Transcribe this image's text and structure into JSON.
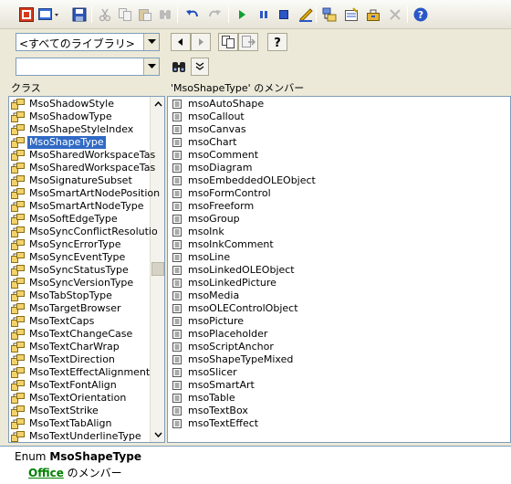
{
  "toolbar": {
    "buttons": [
      "view-code-icon",
      "view-object-icon",
      "save-icon",
      "cut-icon",
      "copy-icon",
      "paste-icon",
      "find-icon",
      "undo-icon",
      "redo-icon",
      "run-icon",
      "break-icon",
      "reset-icon",
      "design-mode-icon",
      "project-explorer-icon",
      "properties-icon",
      "toolbox-icon",
      "close-icon",
      "help-icon"
    ]
  },
  "library_combo": {
    "value": "<すべてのライブラリ>"
  },
  "search_combo": {
    "value": ""
  },
  "classes_header": "クラス",
  "members_header": "'MsoShapeType' のメンバー",
  "classes": [
    "MsoShadowStyle",
    "MsoShadowType",
    "MsoShapeStyleIndex",
    "MsoShapeType",
    "MsoSharedWorkspaceTas",
    "MsoSharedWorkspaceTas",
    "MsoSignatureSubset",
    "MsoSmartArtNodePosition",
    "MsoSmartArtNodeType",
    "MsoSoftEdgeType",
    "MsoSyncConflictResolutio",
    "MsoSyncErrorType",
    "MsoSyncEventType",
    "MsoSyncStatusType",
    "MsoSyncVersionType",
    "MsoTabStopType",
    "MsoTargetBrowser",
    "MsoTextCaps",
    "MsoTextChangeCase",
    "MsoTextCharWrap",
    "MsoTextDirection",
    "MsoTextEffectAlignment",
    "MsoTextFontAlign",
    "MsoTextOrientation",
    "MsoTextStrike",
    "MsoTextTabAlign",
    "MsoTextUnderlineType"
  ],
  "selected_class": "MsoShapeType",
  "members": [
    "msoAutoShape",
    "msoCallout",
    "msoCanvas",
    "msoChart",
    "msoComment",
    "msoDiagram",
    "msoEmbeddedOLEObject",
    "msoFormControl",
    "msoFreeform",
    "msoGroup",
    "msoInk",
    "msoInkComment",
    "msoLine",
    "msoLinkedOLEObject",
    "msoLinkedPicture",
    "msoMedia",
    "msoOLEControlObject",
    "msoPicture",
    "msoPlaceholder",
    "msoScriptAnchor",
    "msoShapeTypeMixed",
    "msoSlicer",
    "msoSmartArt",
    "msoTable",
    "msoTextBox",
    "msoTextEffect"
  ],
  "details": {
    "prefix": "Enum",
    "name": "MsoShapeType",
    "library": "Office",
    "suffix": "のメンバー"
  },
  "colors": {
    "selection": "#316ac5",
    "link": "#008000",
    "chrome": "#ece9d8"
  }
}
